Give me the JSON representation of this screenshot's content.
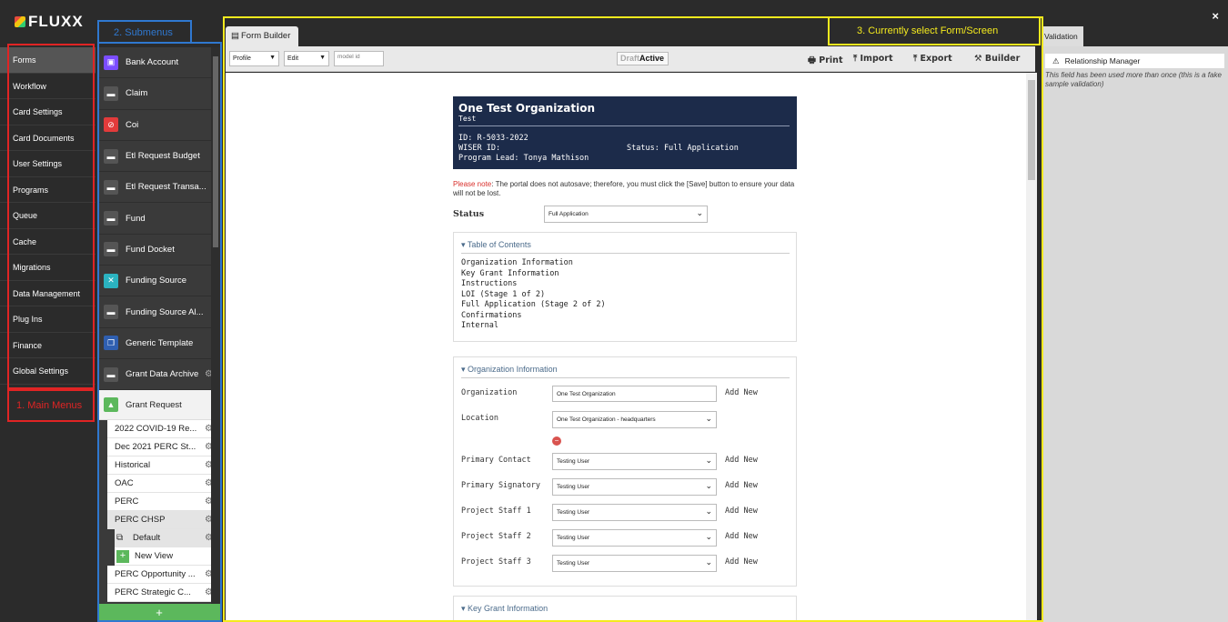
{
  "app": {
    "logo": "FLUXX",
    "close": "×"
  },
  "main_menu": {
    "items": [
      {
        "label": "Forms",
        "selected": true
      },
      {
        "label": "Workflow"
      },
      {
        "label": "Card Settings"
      },
      {
        "label": "Card Documents"
      },
      {
        "label": "User Settings"
      },
      {
        "label": "Programs"
      },
      {
        "label": "Queue"
      },
      {
        "label": "Cache"
      },
      {
        "label": "Migrations"
      },
      {
        "label": "Data Management"
      },
      {
        "label": "Plug Ins"
      },
      {
        "label": "Finance"
      },
      {
        "label": "Global Settings"
      }
    ]
  },
  "submenu": {
    "items": [
      {
        "label": "Bank Account",
        "icon": "bank-icon",
        "color": "#7b4dff"
      },
      {
        "label": "Claim",
        "icon": "folder-icon",
        "color": "#555555"
      },
      {
        "label": "Coi",
        "icon": "prohibited-icon",
        "color": "#e23b3b"
      },
      {
        "label": "Etl Request Budget",
        "icon": "folder-icon",
        "color": "#555555"
      },
      {
        "label": "Etl Request Transa...",
        "icon": "folder-icon",
        "color": "#555555"
      },
      {
        "label": "Fund",
        "icon": "folder-icon",
        "color": "#555555"
      },
      {
        "label": "Fund Docket",
        "icon": "folder-icon",
        "color": "#555555"
      },
      {
        "label": "Funding Source",
        "icon": "tools-icon",
        "color": "#2bb3c0"
      },
      {
        "label": "Funding Source Al...",
        "icon": "folder-icon",
        "color": "#555555"
      },
      {
        "label": "Generic Template",
        "icon": "copy-icon",
        "color": "#2f5fb0"
      },
      {
        "label": "Grant Data Archive",
        "icon": "folder-icon",
        "color": "#555555"
      }
    ],
    "grant_request": {
      "label": "Grant Request"
    },
    "children": [
      {
        "label": "2022 COVID-19 Re..."
      },
      {
        "label": "Dec 2021 PERC St..."
      },
      {
        "label": "Historical"
      },
      {
        "label": "OAC"
      },
      {
        "label": "PERC"
      },
      {
        "label": "PERC CHSP",
        "selected": true
      }
    ],
    "default_view": "Default",
    "new_view": "New View",
    "more_children": [
      {
        "label": "PERC Opportunity ..."
      },
      {
        "label": "PERC Strategic C..."
      }
    ],
    "add": "+"
  },
  "form_builder": {
    "tab": "Form Builder",
    "toolbar": {
      "profile": "Profile",
      "mode": "Edit",
      "model_id_placeholder": "model id",
      "draft": "Draft",
      "active": "Active",
      "print": "Print",
      "import": "Import",
      "export": "Export",
      "builder": "Builder"
    },
    "header": {
      "org": "One Test Organization",
      "sub": "Test",
      "id": "ID: R-5033-2022",
      "wiser": "WISER ID:",
      "lead": "Program Lead: Tonya Mathison",
      "status": "Status: Full Application"
    },
    "note": {
      "prefix": "Please note",
      "text": ": The portal does not autosave; therefore, you must click the [Save] button to ensure your data will not be lost."
    },
    "status": {
      "label": "Status",
      "value": "Full Application"
    },
    "toc": {
      "title": "Table of Contents",
      "items": [
        "Organization Information",
        "Key Grant Information",
        "Instructions",
        "LOI (Stage 1 of 2)",
        "Full Application (Stage 2 of 2)",
        "Confirmations",
        "Internal"
      ]
    },
    "org_info": {
      "title": "Organization Information",
      "add_new": "Add New",
      "organization": {
        "label": "Organization",
        "value": "One Test Organization"
      },
      "location": {
        "label": "Location",
        "value": "One Test Organization - headquarters"
      },
      "fields": [
        {
          "label": "Primary Contact",
          "value": "Testing User"
        },
        {
          "label": "Primary Signatory",
          "value": "Testing User"
        },
        {
          "label": "Project Staff 1",
          "value": "Testing User"
        },
        {
          "label": "Project Staff 2",
          "value": "Testing User"
        },
        {
          "label": "Project Staff 3",
          "value": "Testing User"
        }
      ]
    },
    "key_grant": {
      "title": "Key Grant Information"
    }
  },
  "validation": {
    "tab": "Validation",
    "item": "Relationship Manager",
    "message": "This field has been used more than once (this is a fake sample validation)"
  },
  "annotations": {
    "main": "1. Main Menus",
    "sub": "2. Submenus",
    "current": "3. Currently select Form/Screen"
  }
}
